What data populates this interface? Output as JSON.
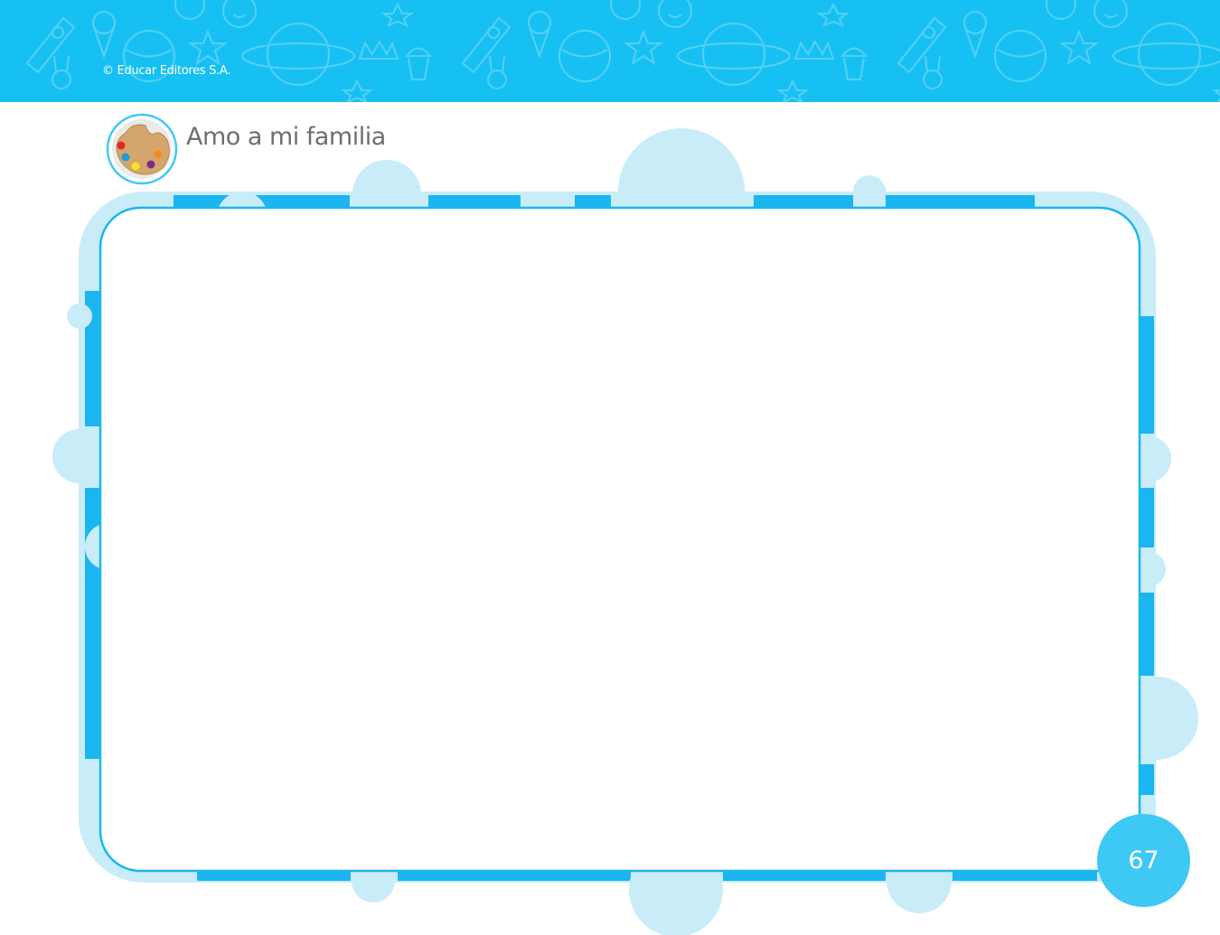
{
  "header": {
    "copyright": "© Educar Editores S.A."
  },
  "activity": {
    "icon": "paint-palette-icon",
    "title": "Amo a mi familia"
  },
  "footer": {
    "page_number": "67"
  },
  "colors": {
    "header_blue": "#17c0f2",
    "frame_blue": "#1bb6ef",
    "frame_light": "#c9ecf9",
    "title_gray": "#6e6f71",
    "page_badge": "#3ec9f5"
  }
}
